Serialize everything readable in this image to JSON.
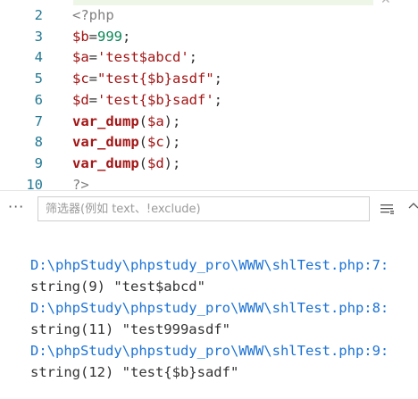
{
  "editor": {
    "lines": [
      {
        "num": "2",
        "tokens": [
          {
            "t": "<?php",
            "c": "php"
          }
        ]
      },
      {
        "num": "3",
        "tokens": [
          {
            "t": "$b",
            "c": "var"
          },
          {
            "t": "=",
            "c": "op"
          },
          {
            "t": "999",
            "c": "num"
          },
          {
            "t": ";",
            "c": "op"
          }
        ]
      },
      {
        "num": "4",
        "tokens": [
          {
            "t": "$a",
            "c": "var"
          },
          {
            "t": "=",
            "c": "op"
          },
          {
            "t": "'test$abcd'",
            "c": "str"
          },
          {
            "t": ";",
            "c": "op"
          }
        ]
      },
      {
        "num": "5",
        "tokens": [
          {
            "t": "$c",
            "c": "var"
          },
          {
            "t": "=",
            "c": "op"
          },
          {
            "t": "\"test{$b}asdf\"",
            "c": "str"
          },
          {
            "t": ";",
            "c": "op"
          }
        ]
      },
      {
        "num": "6",
        "tokens": [
          {
            "t": "$d",
            "c": "var"
          },
          {
            "t": "=",
            "c": "op"
          },
          {
            "t": "'test{$b}sadf'",
            "c": "str"
          },
          {
            "t": ";",
            "c": "op"
          }
        ]
      },
      {
        "num": "7",
        "tokens": [
          {
            "t": "var_dump",
            "c": "fn"
          },
          {
            "t": "(",
            "c": "paren"
          },
          {
            "t": "$a",
            "c": "var"
          },
          {
            "t": ");",
            "c": "paren"
          }
        ]
      },
      {
        "num": "8",
        "tokens": [
          {
            "t": "var_dump",
            "c": "fn"
          },
          {
            "t": "(",
            "c": "paren"
          },
          {
            "t": "$c",
            "c": "var"
          },
          {
            "t": ");",
            "c": "paren"
          }
        ]
      },
      {
        "num": "9",
        "tokens": [
          {
            "t": "var_dump",
            "c": "fn"
          },
          {
            "t": "(",
            "c": "paren"
          },
          {
            "t": "$d",
            "c": "var"
          },
          {
            "t": ");",
            "c": "paren"
          }
        ]
      },
      {
        "num": "10",
        "tokens": [
          {
            "t": "?>",
            "c": "php"
          }
        ]
      }
    ]
  },
  "filter": {
    "placeholder": "筛选器(例如 text、!exclude)",
    "more_label": "···"
  },
  "output": [
    {
      "text": "D:\\phpStudy\\phpstudy_pro\\WWW\\shlTest.php:7:",
      "kind": "path"
    },
    {
      "text": "string(9) \"test$abcd\"",
      "kind": "val"
    },
    {
      "text": "D:\\phpStudy\\phpstudy_pro\\WWW\\shlTest.php:8:",
      "kind": "path"
    },
    {
      "text": "string(11) \"test999asdf\"",
      "kind": "val"
    },
    {
      "text": "D:\\phpStudy\\phpstudy_pro\\WWW\\shlTest.php:9:",
      "kind": "path"
    },
    {
      "text": "string(12) \"test{$b}sadf\"",
      "kind": "val"
    }
  ],
  "icons": {
    "more": "more-horizontal-icon",
    "list": "list-filter-icon",
    "up": "chevron-up-icon",
    "corner": "close-icon"
  },
  "colors": {
    "line_number": "#237893",
    "variable": "#a01010",
    "string": "#a31515",
    "number": "#098658",
    "path": "#1c73d6"
  }
}
